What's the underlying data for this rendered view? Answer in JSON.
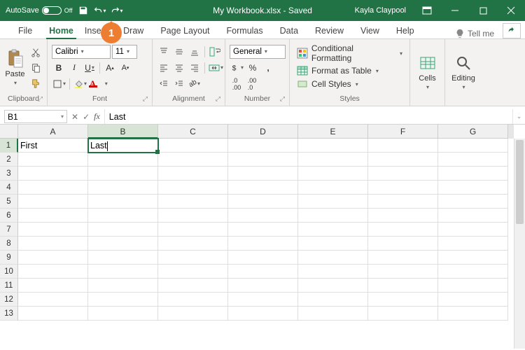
{
  "titlebar": {
    "autosave_label": "AutoSave",
    "autosave_state": "Off",
    "filename": "My Workbook.xlsx",
    "save_state": "Saved",
    "user": "Kayla Claypool"
  },
  "tabs": [
    "File",
    "Home",
    "Insert",
    "Draw",
    "Page Layout",
    "Formulas",
    "Data",
    "Review",
    "View",
    "Help"
  ],
  "active_tab": "Home",
  "tellme": "Tell me",
  "ribbon": {
    "clipboard": {
      "paste": "Paste",
      "label": "Clipboard"
    },
    "font": {
      "label": "Font",
      "name": "Calibri",
      "size": "11",
      "bold": "B",
      "italic": "I",
      "underline": "U"
    },
    "alignment": {
      "label": "Alignment"
    },
    "number": {
      "label": "Number",
      "format": "General"
    },
    "styles": {
      "label": "Styles",
      "cond": "Conditional Formatting",
      "table": "Format as Table",
      "cell": "Cell Styles"
    },
    "cells": {
      "label": "Cells",
      "btn": "Cells"
    },
    "editing": {
      "label": "Editing",
      "btn": "Editing"
    }
  },
  "callout": "1",
  "namebox": "B1",
  "formula": "Last",
  "columns": [
    "A",
    "B",
    "C",
    "D",
    "E",
    "F",
    "G"
  ],
  "rows": [
    "1",
    "2",
    "3",
    "4",
    "5",
    "6",
    "7",
    "8",
    "9",
    "10",
    "11",
    "12",
    "13"
  ],
  "active_col": "B",
  "active_row": "1",
  "cells": {
    "A1": "First",
    "B1": "Last"
  }
}
